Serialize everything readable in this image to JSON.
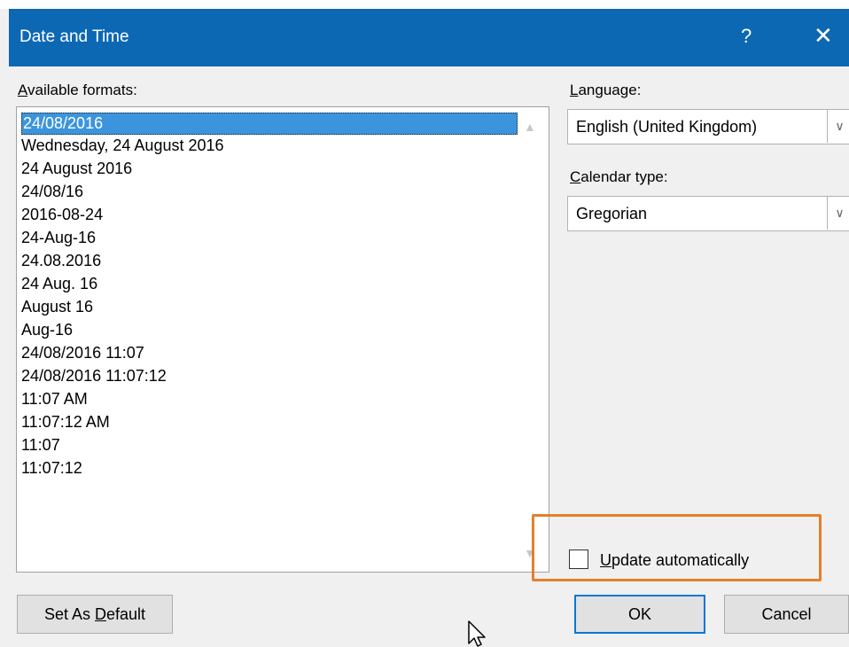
{
  "window": {
    "title": "Date and Time",
    "help": "?",
    "close": "✕"
  },
  "formats": {
    "label": "Available formats:",
    "items": [
      "24/08/2016",
      "Wednesday, 24 August 2016",
      "24 August 2016",
      "24/08/16",
      "2016-08-24",
      "24-Aug-16",
      "24.08.2016",
      "24 Aug. 16",
      "August 16",
      "Aug-16",
      "24/08/2016 11:07",
      "24/08/2016 11:07:12",
      "11:07 AM",
      "11:07:12 AM",
      "11:07",
      "11:07:12"
    ],
    "selected_index": 0
  },
  "language": {
    "label": "Language:",
    "value": "English (United Kingdom)"
  },
  "calendar": {
    "label": "Calendar type:",
    "value": "Gregorian"
  },
  "update": {
    "label": "Update automatically",
    "checked": false
  },
  "buttons": {
    "set_default": "Set As Default",
    "ok": "OK",
    "cancel": "Cancel"
  },
  "colors": {
    "titlebar": "#0c68b3",
    "selection": "#3c95dc",
    "highlight_box": "#e47f2c"
  }
}
